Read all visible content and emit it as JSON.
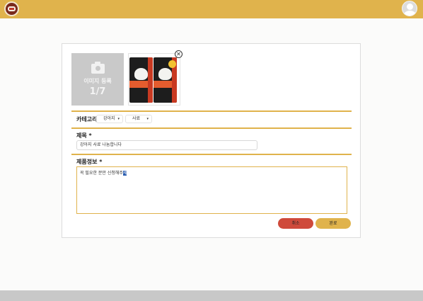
{
  "header": {
    "logo_icon": "brand-logo",
    "avatar_icon": "user-avatar-icon",
    "accent": "#e0b34c"
  },
  "images": {
    "upload_label": "이미지 등록",
    "upload_count": "1/7",
    "upload_icon": "camera-icon",
    "remove_icon": "close-icon",
    "remove_glyph": "✕"
  },
  "category": {
    "label": "카테고리",
    "animal": "강아지",
    "type": "사료",
    "chevron": "▾"
  },
  "title_field": {
    "label": "제목 *",
    "value": "강아지 사료 나눔합니다"
  },
  "description": {
    "label": "제품정보 *",
    "value_text": "꼭 필요한 분만 신청해주",
    "value_highlight": "세"
  },
  "actions": {
    "cancel": "취소",
    "done": "완료",
    "cancel_color": "#cf4a3b"
  }
}
